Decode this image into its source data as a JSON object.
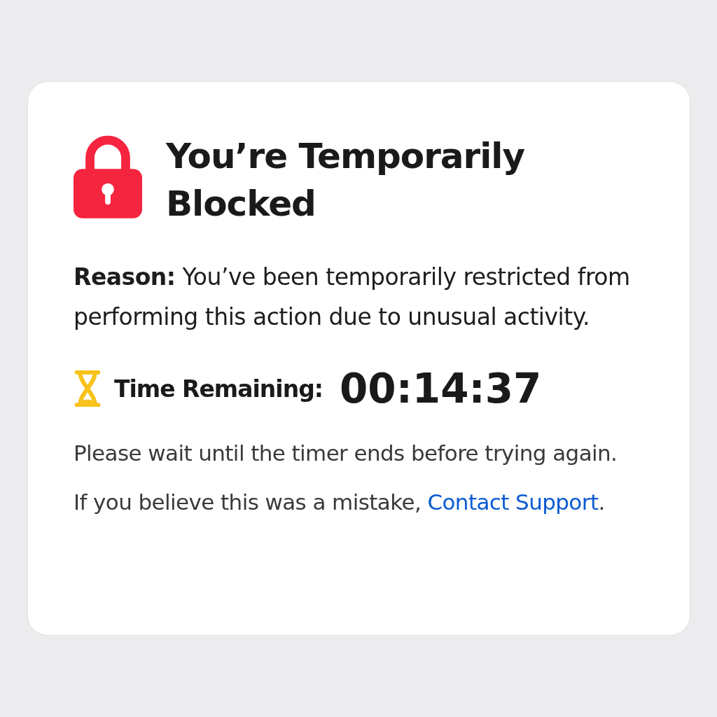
{
  "title": "You’re Temporarily Blocked",
  "reason": "**Reason:** You’ve been temporarily restricted from performing this action due to unusual activity.",
  "timer": {
    "label": "Time Remaining:",
    "value": "00:14:37"
  },
  "instruction": "Please wait until the timer ends before trying again.",
  "support": {
    "before": "If you believe this was a mistake, ",
    "link": "Contact Support",
    "after": "."
  }
}
